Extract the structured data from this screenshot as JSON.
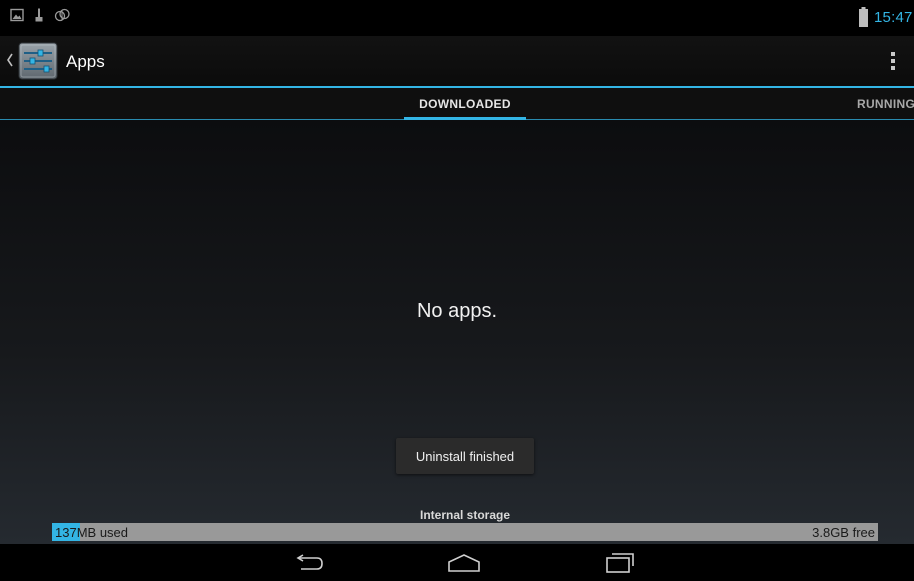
{
  "status_bar": {
    "clock": "15:47",
    "icons": [
      "gallery-icon",
      "usb-icon",
      "android-debug-icon",
      "battery-icon"
    ]
  },
  "action_bar": {
    "title": "Apps",
    "app_icon": "settings-sliders-icon",
    "overflow_icon": "overflow-menu-icon"
  },
  "tabs": [
    {
      "label": "DOWNLOADED",
      "selected": true
    },
    {
      "label": "RUNNING",
      "selected": false
    }
  ],
  "content": {
    "empty_message": "No apps."
  },
  "toast": {
    "message": "Uninstall finished"
  },
  "storage": {
    "label": "Internal storage",
    "used_value": "137",
    "used_suffix": "MB used",
    "free_text": "3.8GB free",
    "used_fraction": 0.034
  },
  "nav_bar": {
    "buttons": [
      "back-icon",
      "home-icon",
      "recent-apps-icon"
    ]
  },
  "colors": {
    "accent": "#33b5e5",
    "storage_track": "#999999"
  }
}
